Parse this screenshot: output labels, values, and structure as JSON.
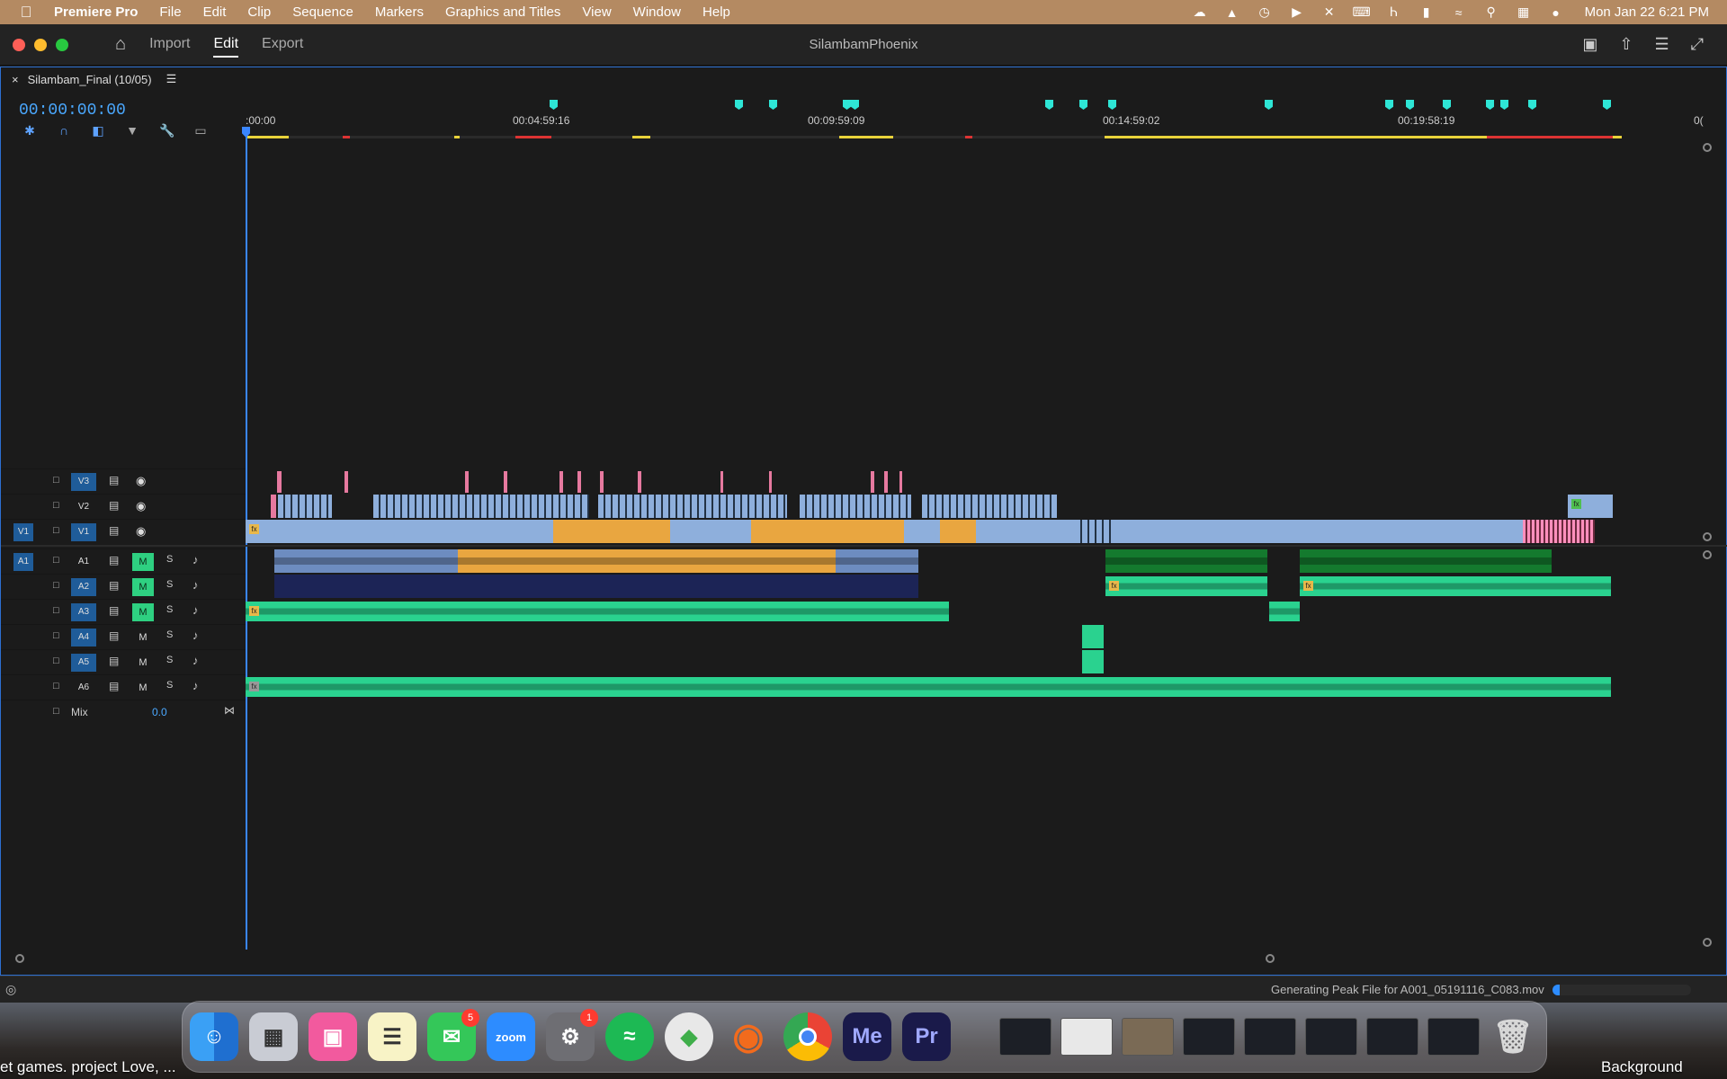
{
  "menubar": {
    "app_name": "Premiere Pro",
    "items": [
      "File",
      "Edit",
      "Clip",
      "Sequence",
      "Markers",
      "Graphics and Titles",
      "View",
      "Window",
      "Help"
    ],
    "clock": "Mon Jan 22  6:21 PM"
  },
  "window": {
    "project_title": "SilambamPhoenix",
    "tabs": [
      {
        "label": "Import",
        "active": false
      },
      {
        "label": "Edit",
        "active": true
      },
      {
        "label": "Export",
        "active": false
      }
    ]
  },
  "timeline": {
    "sequence_tab": "Silambam_Final (10/05)",
    "timecode": "00:00:00:00",
    "ruler_labels": [
      ":00:00",
      "00:04:59:16",
      "00:09:59:09",
      "00:14:59:02",
      "00:19:58:19",
      "0("
    ],
    "video_tracks": [
      {
        "name": "V3",
        "source": ""
      },
      {
        "name": "V2",
        "source": ""
      },
      {
        "name": "V1",
        "source": "V1"
      }
    ],
    "audio_tracks": [
      {
        "name": "A1",
        "source": "A1",
        "mute_on": true
      },
      {
        "name": "A2",
        "source": "",
        "mute_on": true
      },
      {
        "name": "A3",
        "source": "",
        "mute_on": true
      },
      {
        "name": "A4",
        "source": "",
        "mute_on": false
      },
      {
        "name": "A5",
        "source": "",
        "mute_on": false
      },
      {
        "name": "A6",
        "source": "",
        "mute_on": false
      }
    ],
    "mute_label": "M",
    "solo_label": "S",
    "mix_label": "Mix",
    "mix_value": "0.0"
  },
  "status": {
    "message": "Generating Peak File for A001_05191116_C083.mov",
    "progress": 0.05
  },
  "dock": {
    "messages_badge": "5",
    "settings_badge": "1",
    "zoom_label": "zoom",
    "media_encoder_label": "Me",
    "premiere_label": "Pr"
  },
  "desktop": {
    "left_text": "et games.  project Love, ...",
    "right_text": "Background"
  },
  "colors": {
    "accent": "#2c6fd1",
    "timecode": "#4aa8ff",
    "video_clip": "#8eafdc",
    "orange_clip": "#e9a640",
    "audio_green": "#2ad28f",
    "marker": "#2ee6d6",
    "menubar": "#b48a62"
  }
}
